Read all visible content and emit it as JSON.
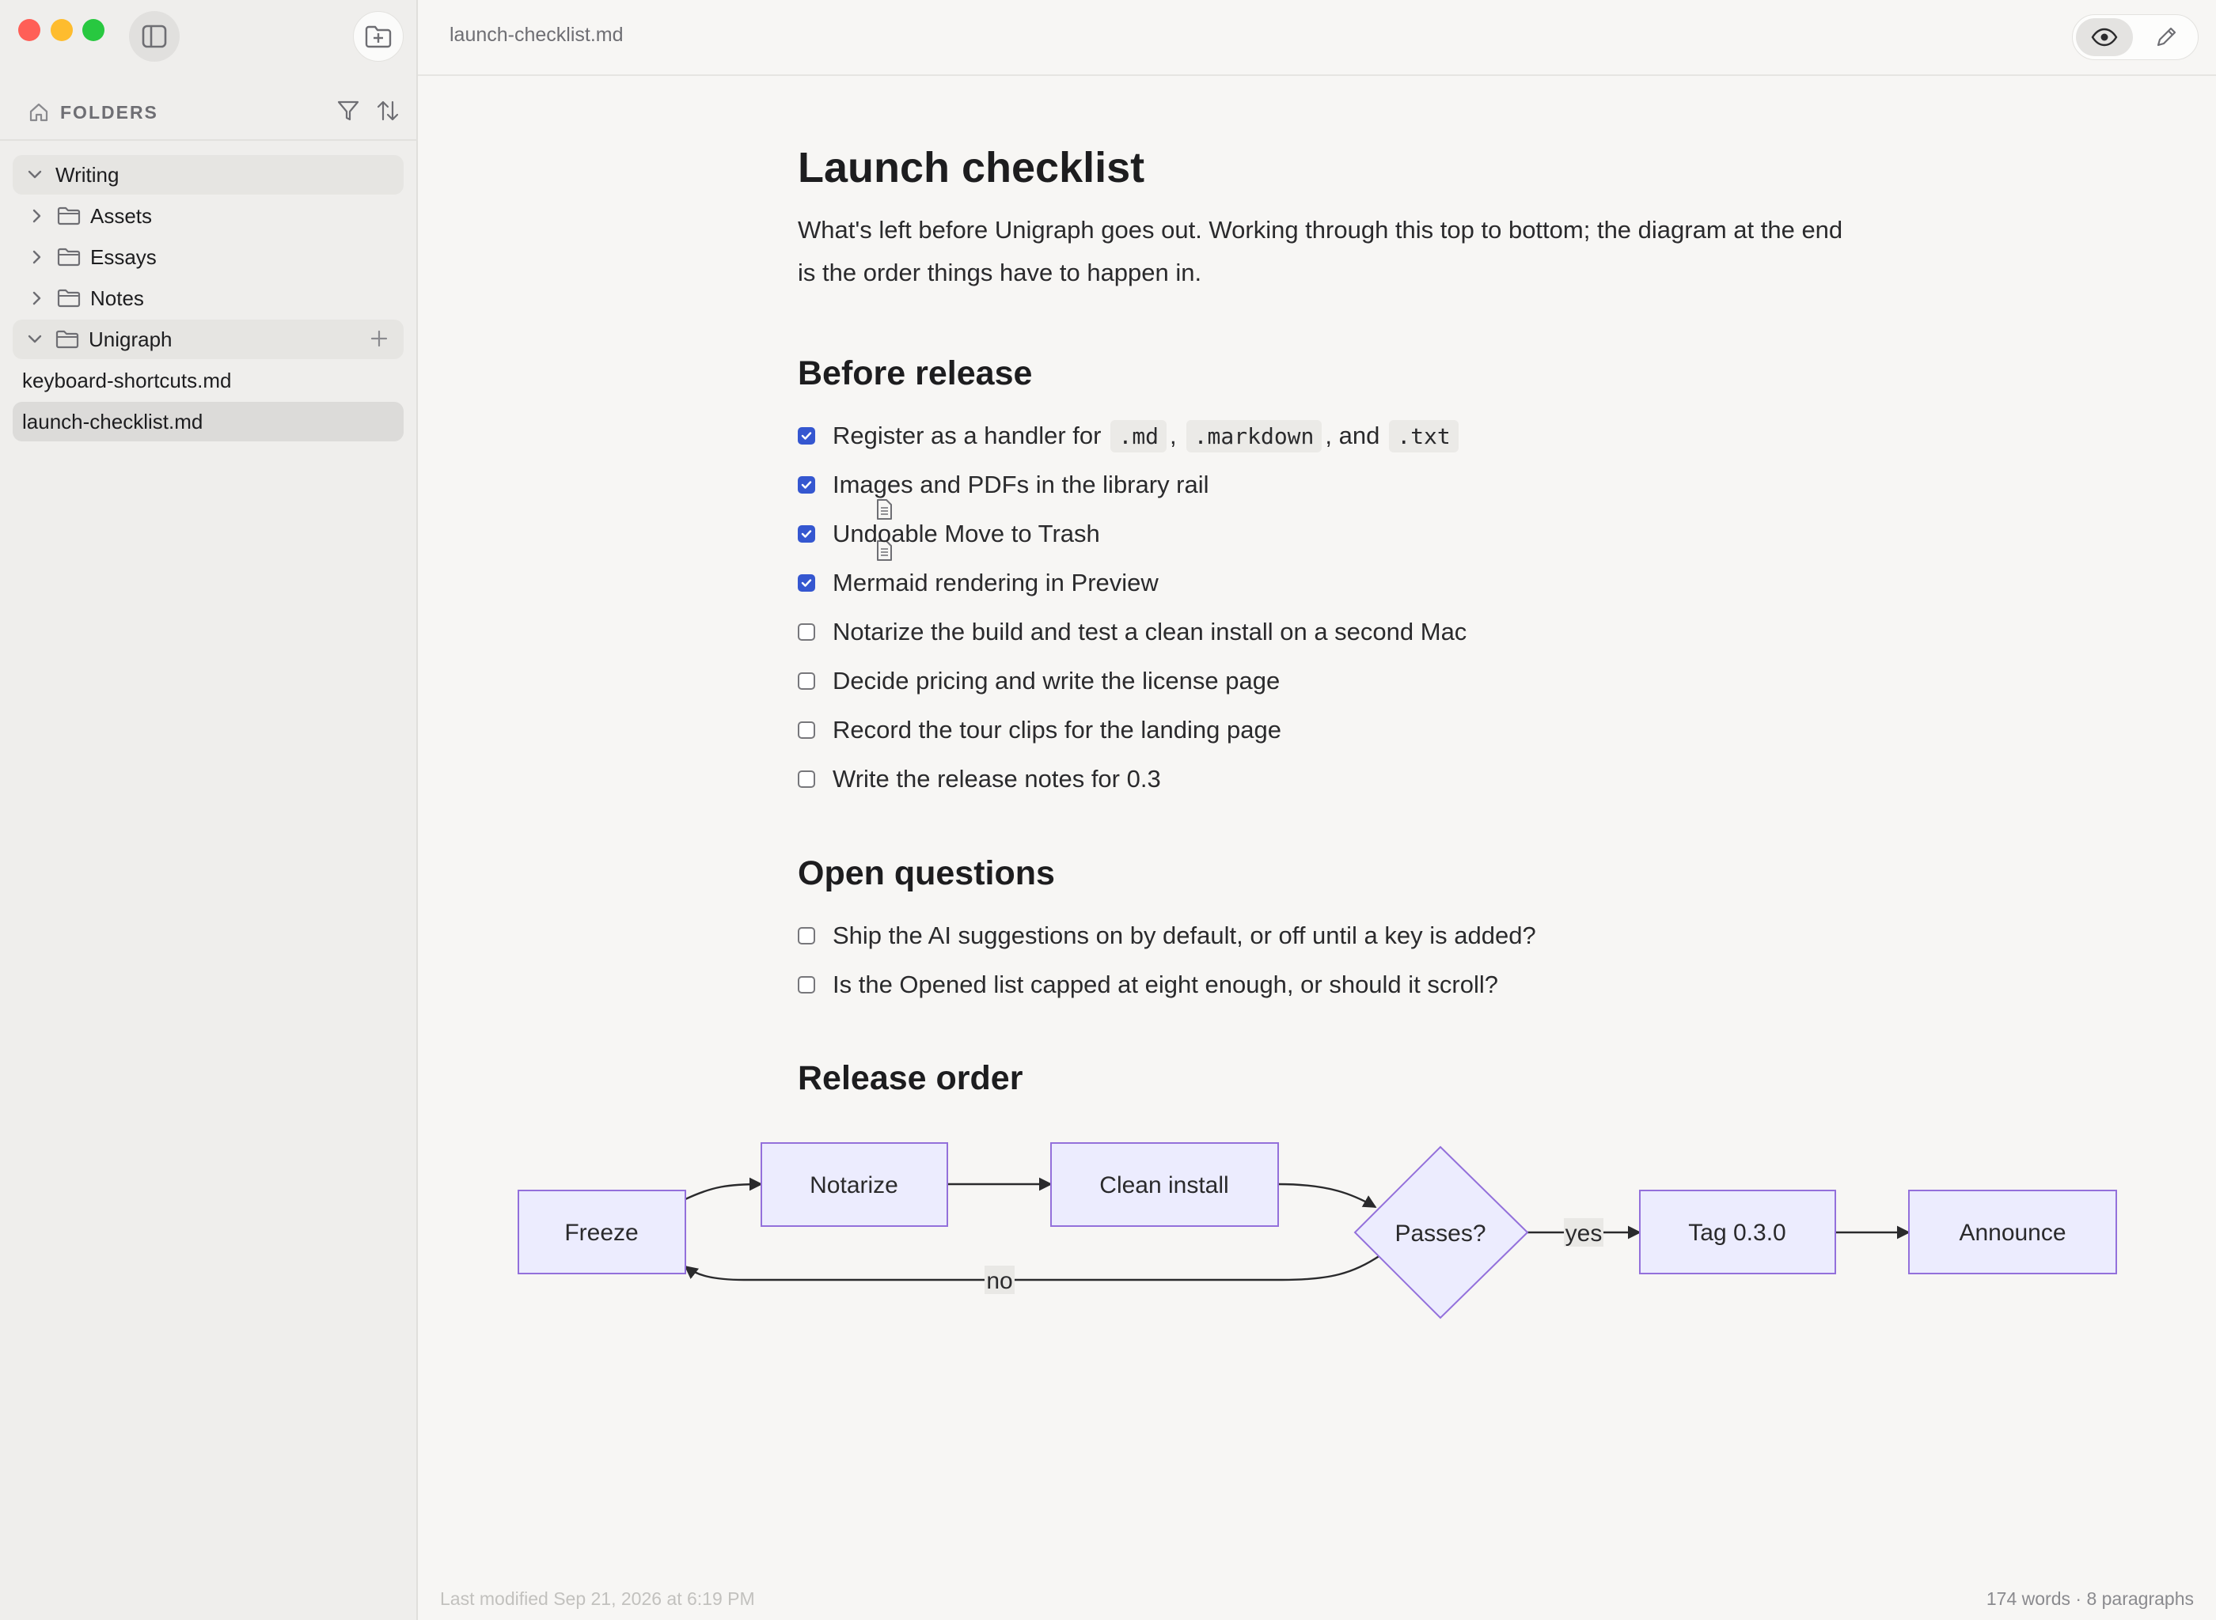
{
  "window": {
    "active_file": "launch-checklist.md"
  },
  "sidebar": {
    "header_label": "FOLDERS",
    "tree": {
      "root": "Writing",
      "folders": [
        "Assets",
        "Essays",
        "Notes",
        "Unigraph"
      ],
      "unigraph_files": [
        "keyboard-shortcuts.md",
        "launch-checklist.md"
      ]
    }
  },
  "toolbar": {
    "preview_icon": "eye-icon",
    "edit_icon": "pencil-icon"
  },
  "document": {
    "title": "Launch checklist",
    "intro": "What's left before Unigraph goes out. Working through this top to bottom; the diagram at the end is the order things have to happen in.",
    "sections": {
      "before_release": {
        "heading": "Before release",
        "item0": {
          "pre": "Register as a handler for",
          "code1": ".md",
          "sep1": ",",
          "code2": ".markdown",
          "sep2": ", and",
          "code3": ".txt",
          "checked": true
        },
        "items": [
          {
            "text": "Images and PDFs in the library rail",
            "checked": true
          },
          {
            "text": "Undoable Move to Trash",
            "checked": true
          },
          {
            "text": "Mermaid rendering in Preview",
            "checked": true
          },
          {
            "text": "Notarize the build and test a clean install on a second Mac",
            "checked": false
          },
          {
            "text": "Decide pricing and write the license page",
            "checked": false
          },
          {
            "text": "Record the tour clips for the landing page",
            "checked": false
          },
          {
            "text": "Write the release notes for 0.3",
            "checked": false
          }
        ]
      },
      "open_questions": {
        "heading": "Open questions",
        "items": [
          {
            "text": "Ship the AI suggestions on by default, or off until a key is added?",
            "checked": false
          },
          {
            "text": "Is the Opened list capped at eight enough, or should it scroll?",
            "checked": false
          }
        ]
      },
      "release_order": {
        "heading": "Release order",
        "nodes": [
          "Freeze",
          "Notarize",
          "Clean install",
          "Passes?",
          "Tag 0.3.0",
          "Announce"
        ],
        "edge_labels": {
          "yes": "yes",
          "no": "no"
        }
      }
    }
  },
  "status": {
    "last_modified": "Last modified Sep 21, 2026 at 6:19 PM",
    "stats": "174 words · 8 paragraphs"
  },
  "colors": {
    "checkbox_on": "#3557d0",
    "node_fill": "#ececfe",
    "node_stroke": "#9370db"
  }
}
